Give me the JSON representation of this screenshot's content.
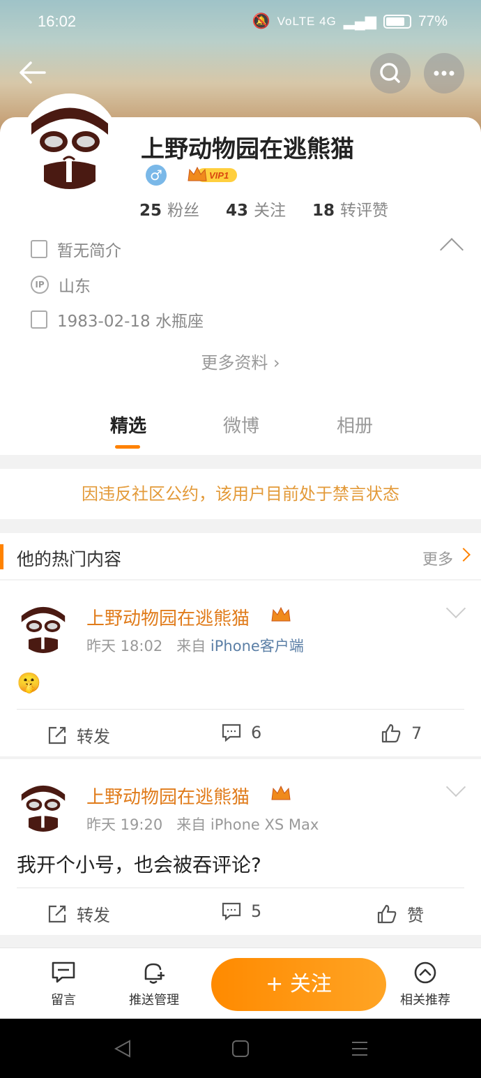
{
  "status_bar": {
    "time": "16:02",
    "signal_label": "VoLTE 4G",
    "battery": "77%"
  },
  "profile": {
    "name": "上野动物园在逃熊猫",
    "gender_symbol": "♂",
    "vip_label": "VIP1",
    "stats": [
      {
        "count": "25",
        "label": "粉丝"
      },
      {
        "count": "43",
        "label": "关注"
      },
      {
        "count": "18",
        "label": "转评赞"
      }
    ],
    "bio": "暂无简介",
    "ip_icon": "IP",
    "location": "山东",
    "birthday": "1983-02-18 水瓶座",
    "more_info": "更多资料 ›"
  },
  "tabs": [
    {
      "label": "精选",
      "active": true
    },
    {
      "label": "微博",
      "active": false
    },
    {
      "label": "相册",
      "active": false
    }
  ],
  "ban_notice": "因违反社区公约，该用户目前处于禁言状态",
  "hot_section": {
    "title": "他的热门内容",
    "more": "更多"
  },
  "posts": [
    {
      "author": "上野动物园在逃熊猫",
      "time": "昨天 18:02",
      "from_prefix": "来自",
      "source": "iPhone客户端",
      "content": "🤫",
      "repost_label": "转发",
      "comments": "6",
      "likes": "7"
    },
    {
      "author": "上野动物园在逃熊猫",
      "time": "昨天 19:20",
      "from_prefix": "来自",
      "source": "iPhone XS Max",
      "content": "我开个小号，也会被吞评论?",
      "repost_label": "转发",
      "comments": "5",
      "likes": "赞"
    }
  ],
  "bottom_bar": {
    "message": "留言",
    "push": "推送管理",
    "follow": "+ 关注",
    "related": "相关推荐"
  },
  "colors": {
    "accent": "#ff8200",
    "ban_text": "#e39a39",
    "source_link": "#5b7fa6"
  }
}
